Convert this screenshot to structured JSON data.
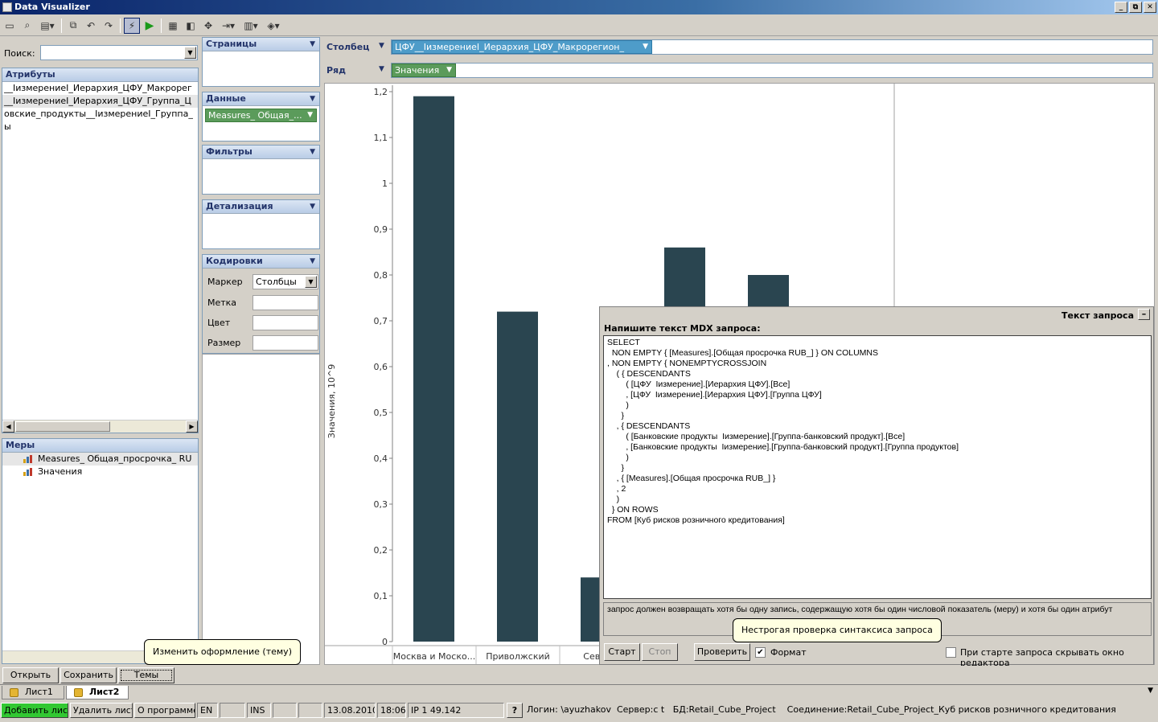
{
  "window": {
    "title": "Data Visualizer",
    "buttons": [
      "_",
      "⧉",
      "✕"
    ]
  },
  "toolbar": {
    "icons": [
      "new-file-icon",
      "print-preview-icon",
      "save-dropdown-icon",
      "copy-icon",
      "undo-icon",
      "redo-icon",
      "run-query-icon",
      "play-icon",
      "layout-icon",
      "swap-icon",
      "move-icon",
      "export-icon",
      "chart-type-icon",
      "theme-icon"
    ]
  },
  "search": {
    "label": "Поиск:",
    "value": ""
  },
  "attributes": {
    "title": "Атрибуты",
    "items": [
      "__IизмерениеI_Иерархия_ЦФУ_Макрорег",
      "__IизмерениеI_Иерархия_ЦФУ_Группа_Ц",
      "овские_продукты__IизмерениеI_Группа_",
      "ы"
    ]
  },
  "measures": {
    "title": "Меры",
    "items": [
      "Measures_ Общая_просрочка_ RU",
      "Значения"
    ]
  },
  "shelves": {
    "pages": {
      "title": "Страницы"
    },
    "data": {
      "title": "Данные",
      "chip": "Measures_ Общая_..."
    },
    "filters": {
      "title": "Фильтры"
    },
    "detail": {
      "title": "Детализация"
    },
    "encodings": {
      "title": "Кодировки",
      "marker_label": "Маркер",
      "marker_value": "Столбцы",
      "label_label": "Метка",
      "color_label": "Цвет",
      "size_label": "Размер"
    },
    "column": {
      "label": "Столбец",
      "chip": "ЦФУ__IизмерениеI_Иерархия_ЦФУ_Макрорегион_"
    },
    "row": {
      "label": "Ряд",
      "chip": "Значения"
    }
  },
  "chart_data": {
    "type": "bar",
    "categories": [
      "Москва и Моско...",
      "Приволжский",
      "Северо-",
      "",
      ""
    ],
    "values": [
      1.19,
      0.72,
      0.14,
      0.86,
      0.8
    ],
    "ylabel": "Значения, 10^9",
    "ylim": [
      0,
      1.2
    ],
    "yticks": [
      "0",
      "0,1",
      "0,2",
      "0,3",
      "0,4",
      "0,5",
      "0,6",
      "0,7",
      "0,8",
      "0,9",
      "1",
      "1,1",
      "1,2"
    ],
    "bar_color": "#2a4550",
    "grid": false
  },
  "query_panel": {
    "title": "Текст запроса",
    "caption": "Напишите текст MDX запроса:",
    "query": "SELECT\n  NON EMPTY { [Measures].[Общая просрочка RUB_] } ON COLUMNS\n, NON EMPTY { NONEMPTYCROSSJOIN\n    ( { DESCENDANTS\n        ( [ЦФУ  Iизмерение].[Иерархия ЦФУ].[Все]\n        , [ЦФУ  Iизмерение].[Иерархия ЦФУ].[Группа ЦФУ]\n        )\n      }\n    , { DESCENDANTS\n        ( [Банковские продукты  Iизмерение].[Группа-банковский продукт].[Все]\n        , [Банковские продукты  Iизмерение].[Группа-банковский продукт].[Группа продуктов]\n        )\n      }\n    , { [Measures].[Общая просрочка RUB_] }\n    , 2\n    )\n  } ON ROWS\nFROM [Куб рисков розничного кредитования]",
    "message": "запрос должен возвращать хотя бы одну запись, содержащую хотя бы один числовой показатель (меру) и хотя бы один атрибут",
    "start_btn": "Старт",
    "stop_btn": "Стоп",
    "check_btn": "Проверить",
    "format_label": "Формат",
    "format_checked": "✔",
    "hide_label": "При старте запроса скрывать окно редактора"
  },
  "tooltips": {
    "syntax": "Нестрогая проверка синтаксиса запроса",
    "theme": "Изменить оформление (тему)"
  },
  "bottom_buttons": {
    "open": "Открыть",
    "save": "Сохранить",
    "themes": "Темы"
  },
  "sheets": [
    "Лист1",
    "Лист2"
  ],
  "status": {
    "add_sheet": "Добавить лист",
    "delete_sheet": "Удалить лист",
    "about": "О программе",
    "lang": "EN",
    "ins": "INS",
    "date": "13.08.2010",
    "time": "18:06",
    "ip": "IP 1   49.142",
    "help": "?",
    "login": "Логин:     \\ayuzhakov",
    "server": "Сервер:c          t",
    "db": "БД:Retail_Cube_Project",
    "connection": "Соединение:Retail_Cube_Project_Куб рисков розничного кредитования"
  }
}
